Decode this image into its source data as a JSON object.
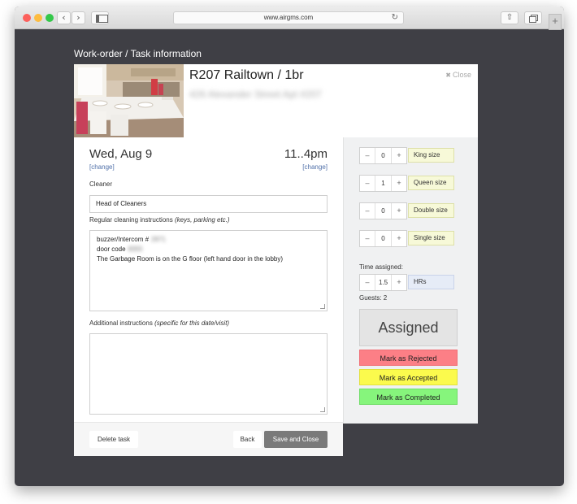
{
  "browser": {
    "url": "www.airgms.com",
    "nav_back_icon": "‹",
    "nav_forward_icon": "›",
    "reload_icon": "↻",
    "share_icon": "⇧",
    "new_tab_icon": "+"
  },
  "page": {
    "title": "Work-order / Task information"
  },
  "property": {
    "title": "R207 Railtown / 1br",
    "address": "426 Alexander Street Apt #207",
    "close_icon": "✖",
    "close_label": "Close"
  },
  "schedule": {
    "date": "Wed, Aug 9",
    "date_change": "[change]",
    "time": "11..4pm",
    "time_change": "[change]"
  },
  "form": {
    "cleaner_label": "Cleaner",
    "cleaner_value": "Head of Cleaners",
    "regular_label": "Regular cleaning instructions",
    "regular_hint": "(keys, parking etc.)",
    "regular_line1_prefix": "buzzer/Intercom #",
    "regular_line1_blurred": "2971",
    "regular_line2_prefix": "door code",
    "regular_line2_blurred": "8355",
    "regular_line3": "The Garbage Room is on the G floor (left hand door in the lobby)",
    "additional_label": "Additional instructions",
    "additional_hint": "(specific for this date/visit)",
    "additional_value": ""
  },
  "footer": {
    "delete_label": "Delete task",
    "back_label": "Back",
    "save_label": "Save and Close"
  },
  "beds": [
    {
      "label": "King size",
      "count": "0"
    },
    {
      "label": "Queen size",
      "count": "1"
    },
    {
      "label": "Double size",
      "count": "0"
    },
    {
      "label": "Single size",
      "count": "0"
    }
  ],
  "stepper": {
    "minus": "–",
    "plus": "+"
  },
  "time_assigned": {
    "label": "Time assigned:",
    "value": "1.5",
    "unit": "HRs"
  },
  "guests": {
    "label": "Guests: 2"
  },
  "status": {
    "current": "Assigned",
    "reject_label": "Mark as Rejected",
    "accept_label": "Mark as Accepted",
    "complete_label": "Mark as Completed",
    "colors": {
      "rejected": "#fc7f86",
      "accepted": "#fbfa4d",
      "completed": "#86f57c"
    }
  }
}
